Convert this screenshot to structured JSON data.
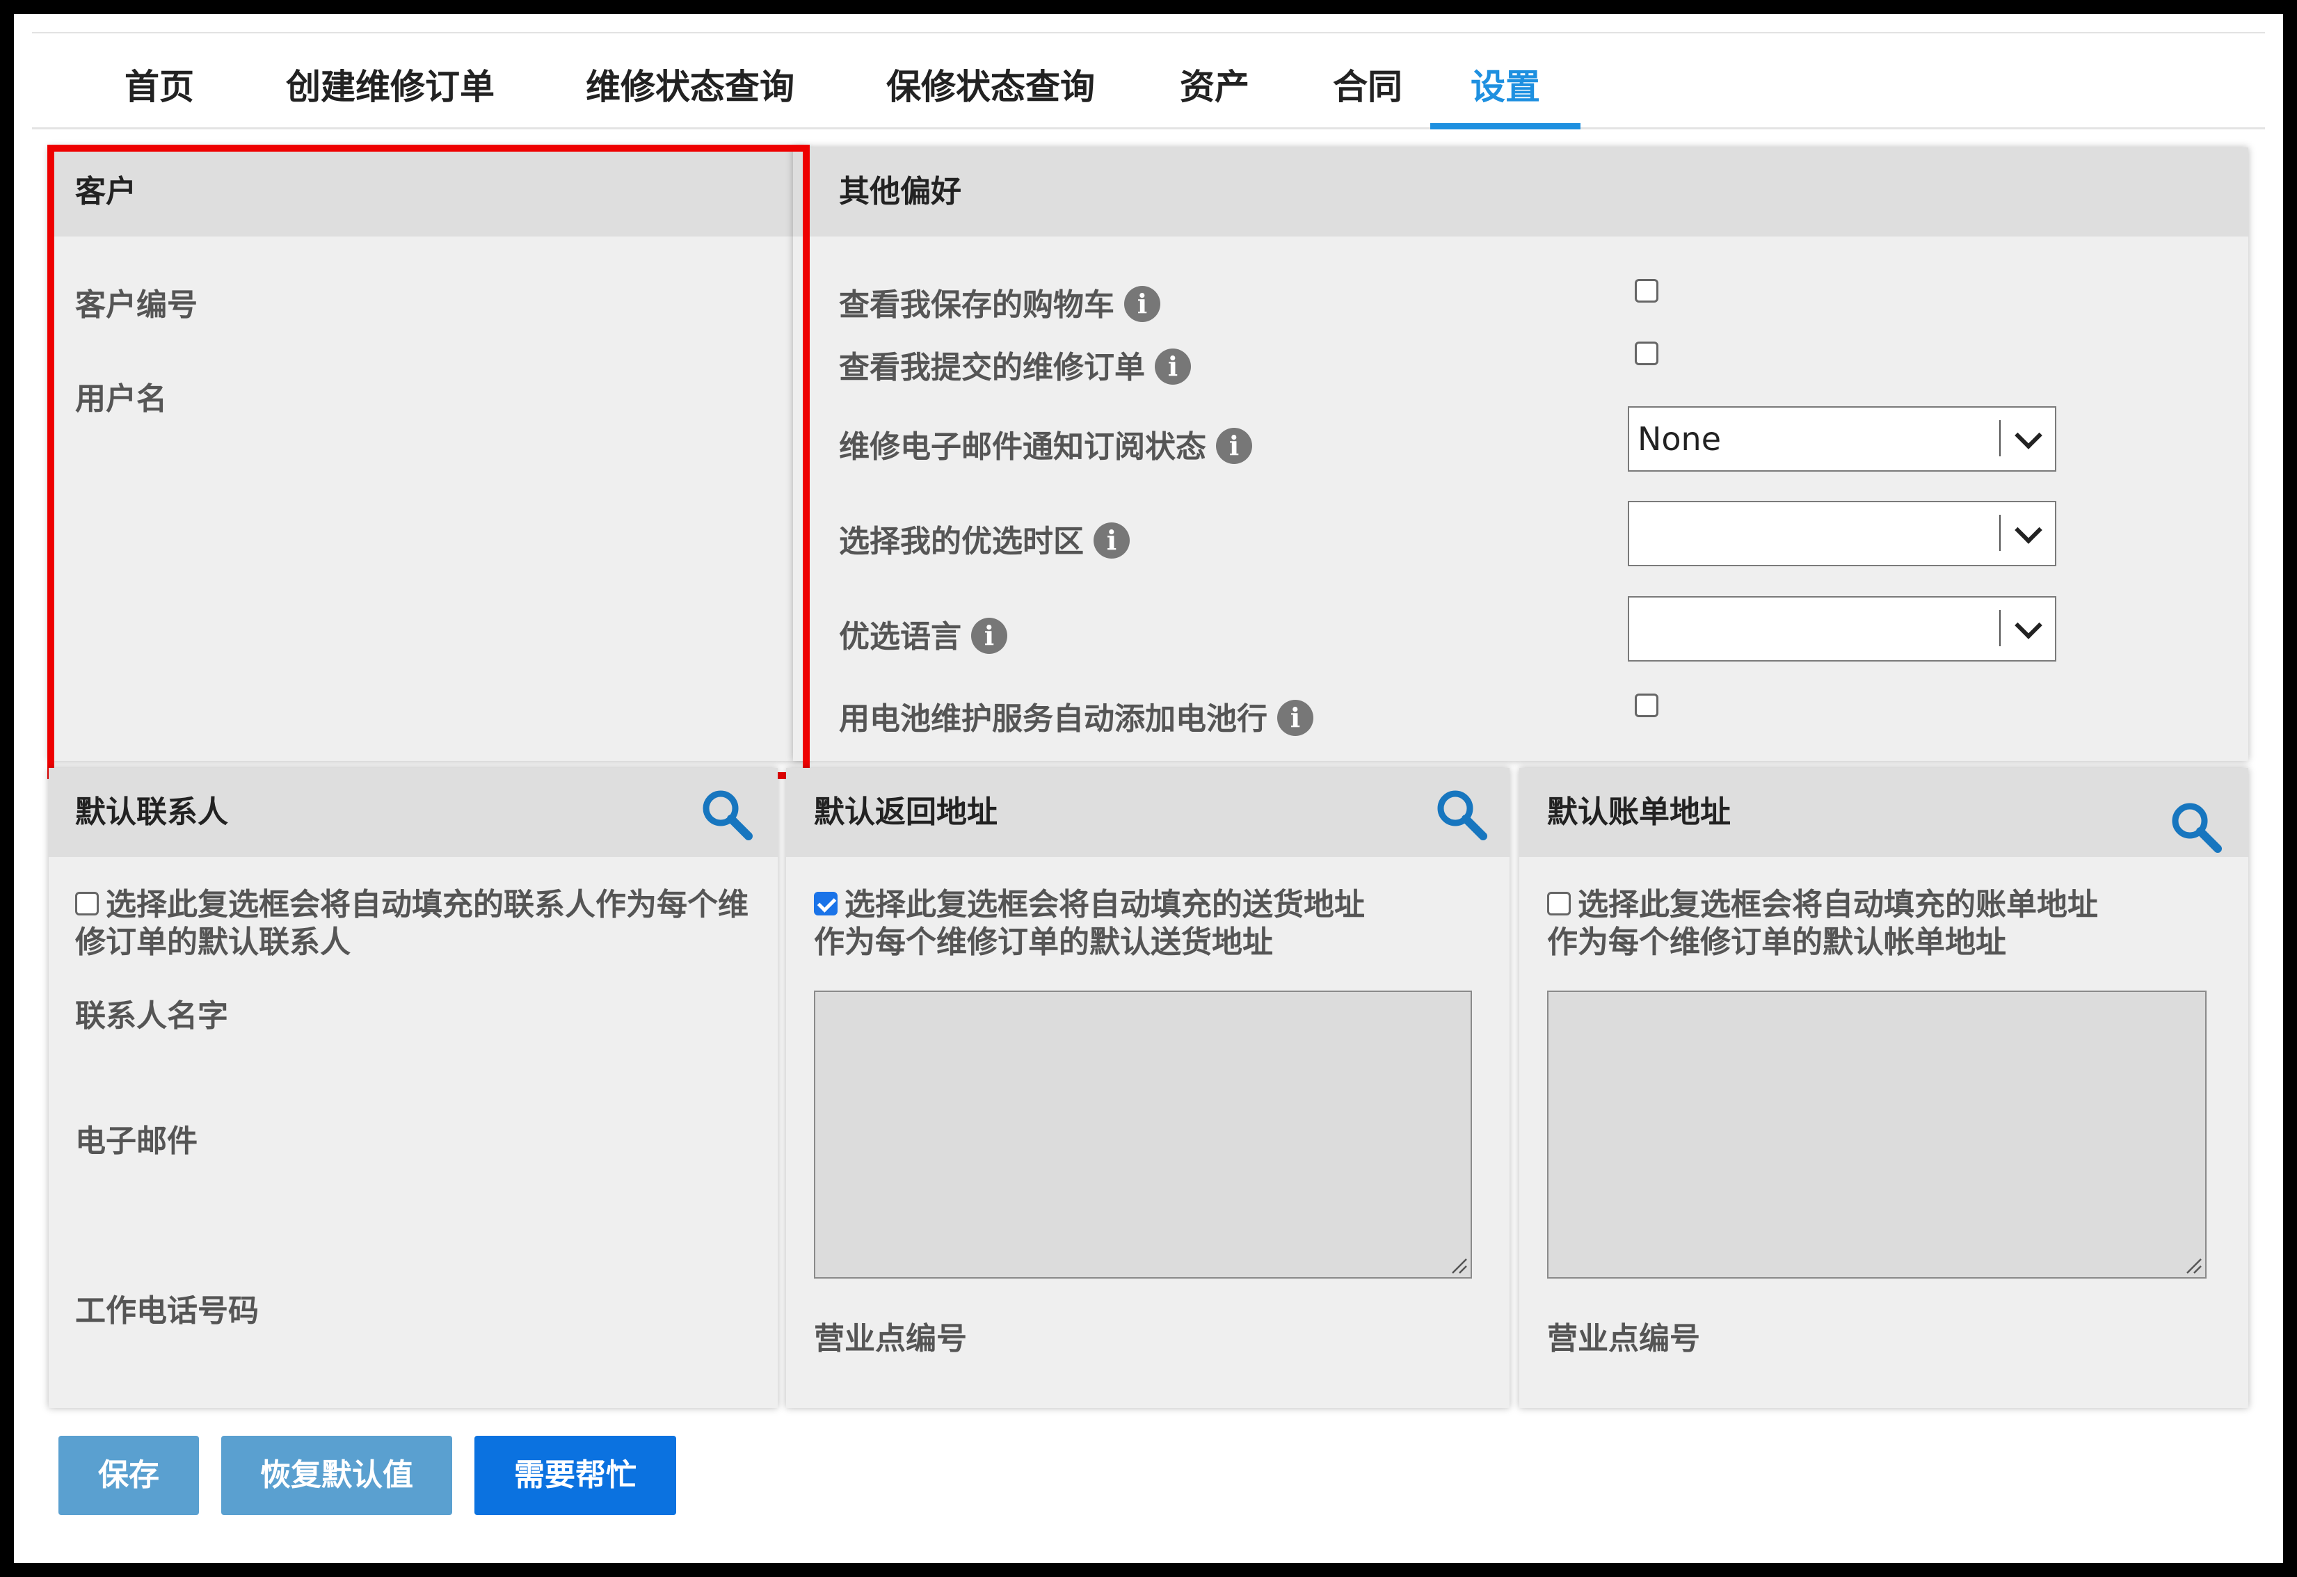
{
  "nav": {
    "tabs": [
      {
        "label": "首页"
      },
      {
        "label": "创建维修订单"
      },
      {
        "label": "维修状态查询"
      },
      {
        "label": "保修状态查询"
      },
      {
        "label": "资产"
      },
      {
        "label": "合同"
      },
      {
        "label": "设置",
        "active": true
      }
    ]
  },
  "customer": {
    "title": "客户",
    "customer_number_label": "客户编号",
    "username_label": "用户名"
  },
  "preferences": {
    "title": "其他偏好",
    "view_saved_cart": {
      "label": "查看我保存的购物车",
      "checked": false
    },
    "view_submitted_orders": {
      "label": "查看我提交的维修订单",
      "checked": false
    },
    "email_subscription": {
      "label": "维修电子邮件通知订阅状态",
      "value": "None"
    },
    "timezone": {
      "label": "选择我的优选时区",
      "value": ""
    },
    "language": {
      "label": "优选语言",
      "value": ""
    },
    "battery_auto_add": {
      "label": "用电池维护服务自动添加电池行",
      "checked": false
    }
  },
  "default_contact": {
    "title": "默认联系人",
    "checkbox_text": "选择此复选框会将自动填充的联系人作为每个维修订单的默认联系人",
    "checked": false,
    "name_label": "联系人名字",
    "email_label": "电子邮件",
    "phone_label": "工作电话号码"
  },
  "default_return_address": {
    "title": "默认返回地址",
    "checkbox_line1": "选择此复选框会将自动填充的送货地址",
    "checkbox_line2": "作为每个维修订单的默认送货地址",
    "checked": true,
    "site_label": "营业点编号"
  },
  "default_billing_address": {
    "title": "默认账单地址",
    "checkbox_line1": "选择此复选框会将自动填充的账单地址",
    "checkbox_line2": "作为每个维修订单的默认帐单地址",
    "checked": false,
    "site_label": "营业点编号"
  },
  "buttons": {
    "save": "保存",
    "restore_defaults": "恢复默认值",
    "need_help": "需要帮忙"
  },
  "colors": {
    "accent": "#1e90e0",
    "highlight_box": "#ee0000",
    "primary_button": "#0b72e0",
    "soft_button": "#5aa0d0"
  }
}
